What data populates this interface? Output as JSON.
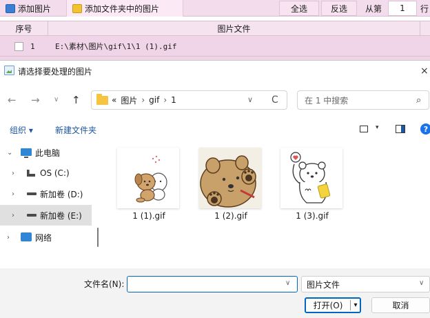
{
  "app": {
    "toolbar": {
      "add_image": "添加图片",
      "add_folder_images": "添加文件夹中的图片",
      "select_all": "全选",
      "invert_selection": "反选",
      "from_page_label": "从第",
      "page_value": "1",
      "row_label": "行"
    },
    "table": {
      "headers": [
        "序号",
        "图片文件"
      ],
      "rows": [
        {
          "index": "1",
          "path": "E:\\素材\\图片\\gif\\1\\1 (1).gif"
        }
      ]
    }
  },
  "dialog": {
    "title": "请选择要处理的图片",
    "close_glyph": "×",
    "nav": {
      "back": "←",
      "forward": "→",
      "history": "∨",
      "up": "↑",
      "breadcrumb": [
        "«",
        "图片",
        "›",
        "gif",
        "›",
        "1"
      ],
      "refresh": "C",
      "dropdown": "∨"
    },
    "search": {
      "placeholder": "在 1 中搜索",
      "icon": "search-icon"
    },
    "commands": {
      "organize": "组织 ▾",
      "new_folder": "新建文件夹",
      "view_caret": "▾",
      "help": "?"
    },
    "tree": [
      {
        "chevron": "⌄",
        "label": "此电脑",
        "icon": "computer-icon"
      },
      {
        "chevron": "›",
        "label": "OS (C:)",
        "icon": "windows-drive-icon"
      },
      {
        "chevron": "›",
        "label": "新加卷 (D:)",
        "icon": "drive-icon"
      },
      {
        "chevron": "›",
        "label": "新加卷 (E:)",
        "icon": "drive-icon",
        "selected": true
      },
      {
        "chevron": "›",
        "label": "网络",
        "icon": "network-icon"
      }
    ],
    "files": [
      {
        "name": "1 (1).gif"
      },
      {
        "name": "1 (2).gif"
      },
      {
        "name": "1 (3).gif"
      }
    ],
    "footer": {
      "filename_label": "文件名(N):",
      "filename_value": "",
      "filetype": "图片文件",
      "open": "打开(O)",
      "open_caret": "▾",
      "cancel": "取消",
      "caret": "∨"
    }
  }
}
